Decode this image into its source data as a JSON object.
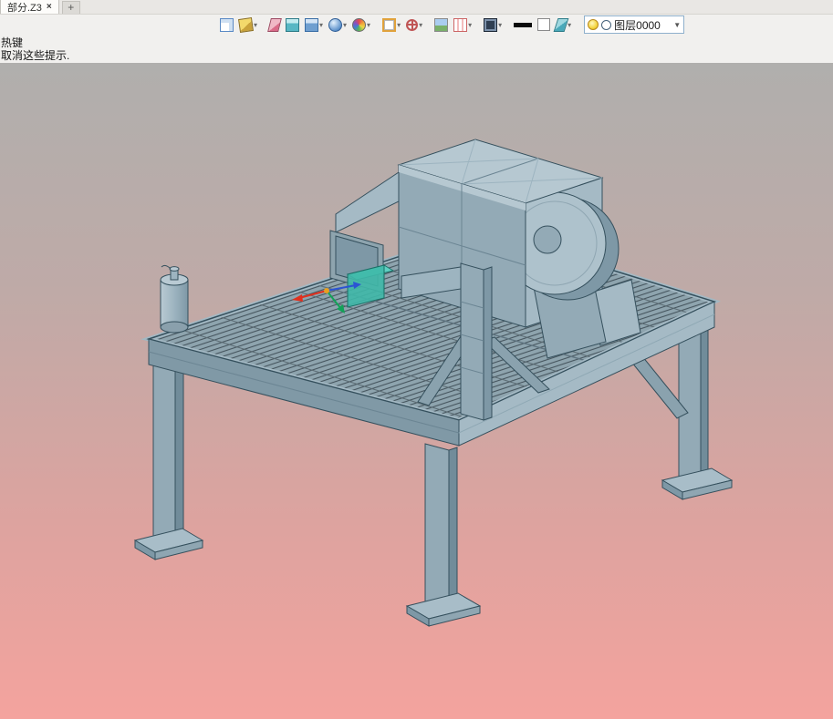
{
  "tab_bar": {
    "active_tab": {
      "label": "部分.Z3",
      "close": "×"
    },
    "new_tab": "+"
  },
  "hints": {
    "line1": "热键",
    "line2": "取消这些提示."
  },
  "toolbar": {
    "dropdown_glyph": "▾",
    "icons": [
      {
        "name": "print-preview-icon",
        "glyph": "sheet",
        "dropdown": false
      },
      {
        "name": "paint-bucket-icon",
        "glyph": "bucket",
        "dropdown": true
      },
      {
        "glyph": "sep"
      },
      {
        "name": "eraser-icon",
        "glyph": "eraser",
        "dropdown": false
      },
      {
        "name": "shaded-solid-icon",
        "glyph": "cube-teal",
        "dropdown": false
      },
      {
        "name": "display-mode-icon",
        "glyph": "cube-blue",
        "dropdown": true
      },
      {
        "name": "render-mode-icon",
        "glyph": "sphere",
        "dropdown": true
      },
      {
        "name": "color-wheel-icon",
        "glyph": "wheel",
        "dropdown": true
      },
      {
        "glyph": "sep"
      },
      {
        "name": "section-view-icon",
        "glyph": "section",
        "dropdown": true
      },
      {
        "name": "point-snap-icon",
        "glyph": "target",
        "dropdown": true
      },
      {
        "glyph": "sep"
      },
      {
        "name": "image-icon",
        "glyph": "image",
        "dropdown": false
      },
      {
        "name": "clip-plane-icon",
        "glyph": "clip",
        "dropdown": true
      },
      {
        "glyph": "sep"
      },
      {
        "name": "monitor-icon",
        "glyph": "monitor",
        "dropdown": true
      },
      {
        "glyph": "sep"
      },
      {
        "name": "line-width-swatch",
        "glyph": "black-bar",
        "dropdown": false
      },
      {
        "name": "background-swatch",
        "glyph": "white-square",
        "dropdown": false
      },
      {
        "name": "layers-icon",
        "glyph": "layers",
        "dropdown": true
      },
      {
        "glyph": "sep"
      }
    ],
    "layer_combo": {
      "value": "图层0000",
      "arrow": "▼"
    }
  },
  "viewport": {
    "scene": "steel-platform-with-centrifugal-fan-3d-model",
    "gradient_top": "#b0afad",
    "gradient_bottom": "#f4a39e",
    "selection_color": "#3fb8a9",
    "triad_colors": {
      "x": "#e0301e",
      "y": "#12a258",
      "z": "#2b54d4",
      "origin": "#e8a020"
    },
    "steel_palette": {
      "light": "#b6c8d1",
      "mid": "#93aab6",
      "dark": "#7e98a6",
      "outline": "#35505d"
    }
  }
}
